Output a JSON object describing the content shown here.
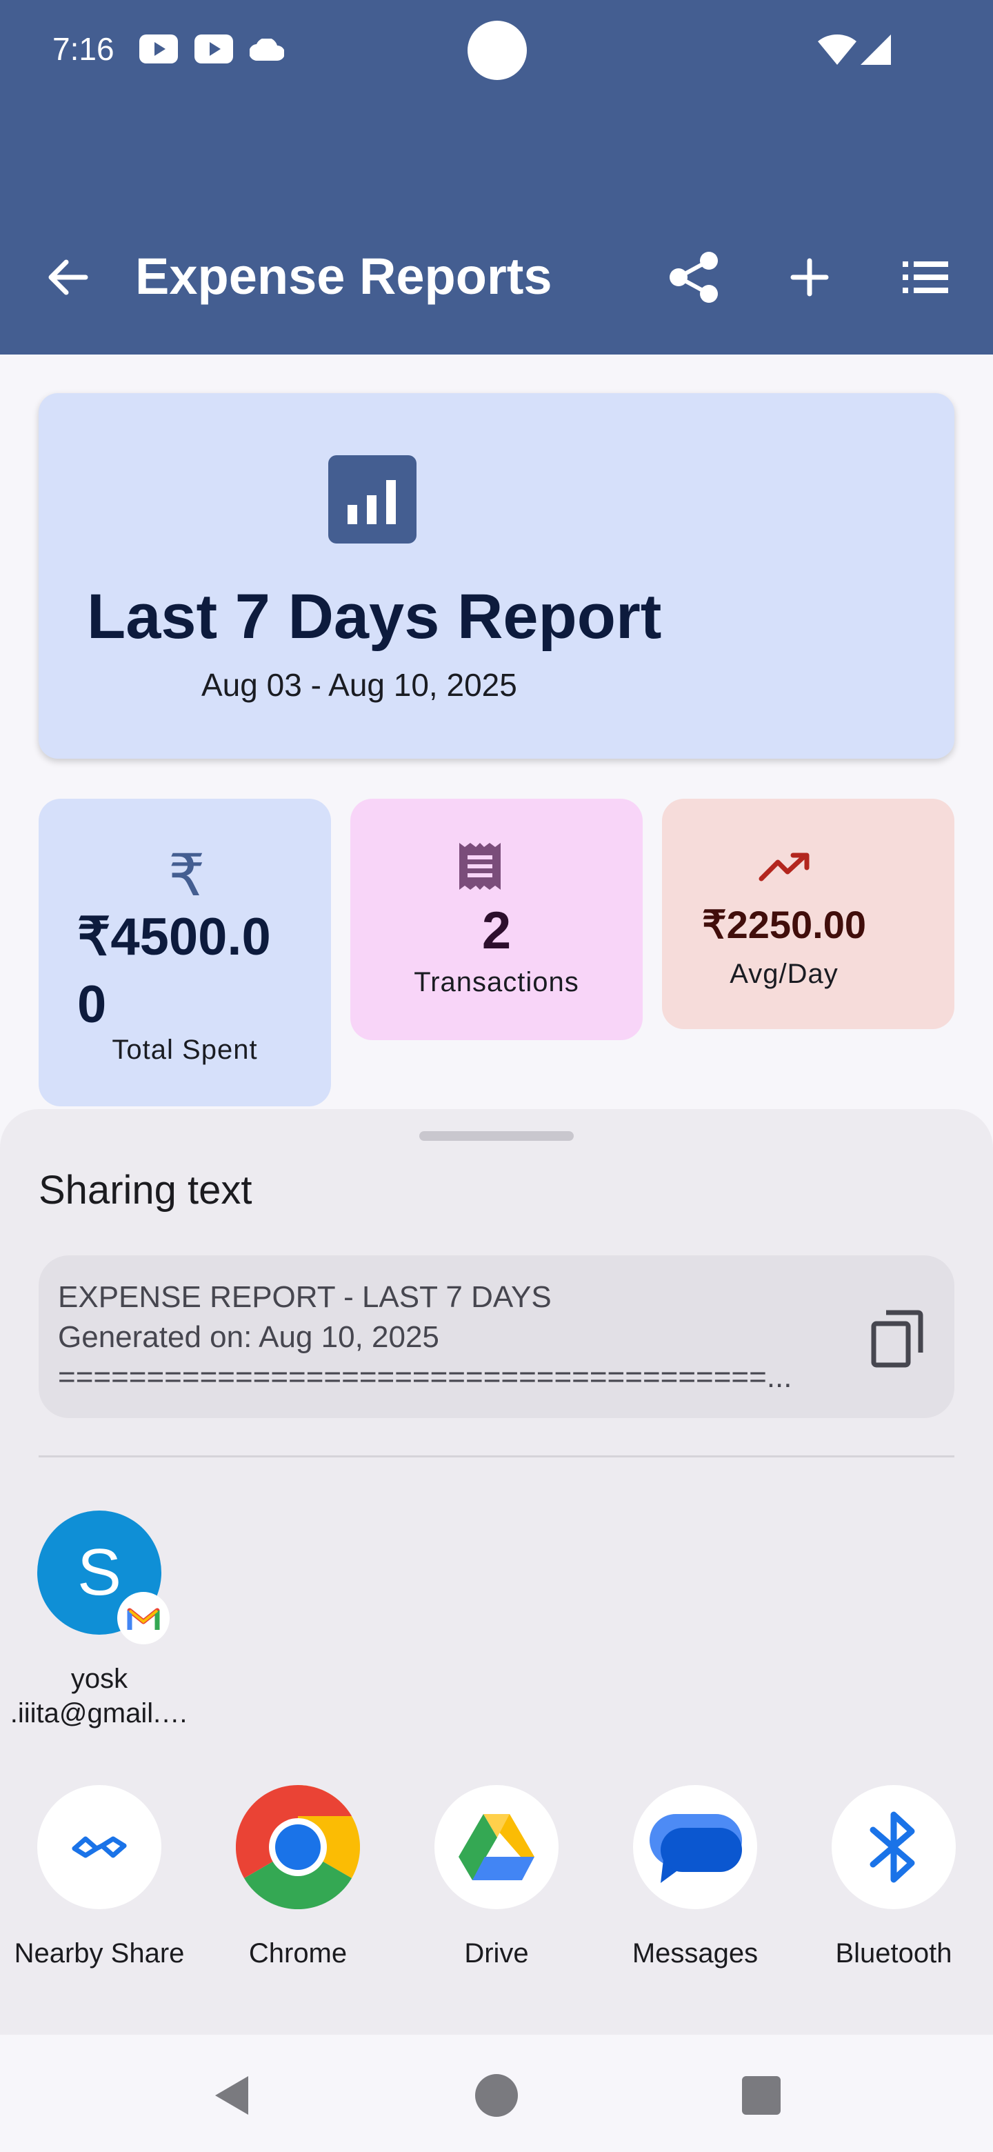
{
  "status_bar": {
    "time": "7:16",
    "icons": [
      "youtube-icon",
      "youtube-icon",
      "cloud-icon",
      "wifi-icon",
      "signal-icon"
    ]
  },
  "toolbar": {
    "title": "Expense Reports",
    "actions": [
      "back-arrow-icon",
      "share-icon",
      "add-icon",
      "list-icon"
    ]
  },
  "report": {
    "icon": "bar-chart-icon",
    "title": "Last 7 Days Report",
    "date_range": "Aug 03 - Aug 10, 2025"
  },
  "stats": [
    {
      "icon": "rupee-icon",
      "value_line1": "₹4500.0",
      "value_line2": "0",
      "label": "Total Spent"
    },
    {
      "icon": "receipt-icon",
      "value": "2",
      "label": "Transactions"
    },
    {
      "icon": "trending-up-icon",
      "value": "₹2250.00",
      "label": "Avg/Day"
    }
  ],
  "share_sheet": {
    "title": "Sharing text",
    "preview_lines": [
      "EXPENSE REPORT - LAST 7 DAYS",
      "Generated on: Aug 10, 2025",
      "========================================..."
    ],
    "contact": {
      "initial": "S",
      "name_line1": "yosk",
      "name_line2": ".iiita@gmail.…"
    },
    "apps": [
      {
        "label": "Nearby Share",
        "icon": "nearby-share-icon"
      },
      {
        "label": "Chrome",
        "icon": "chrome-icon"
      },
      {
        "label": "Drive",
        "icon": "drive-icon"
      },
      {
        "label": "Messages",
        "icon": "messages-icon"
      },
      {
        "label": "Bluetooth",
        "icon": "bluetooth-icon"
      }
    ]
  },
  "colors": {
    "app_bar": "#445e91",
    "hero_card": "#d6e0fa",
    "stat_pink": "#f8d5f8",
    "stat_red": "#f6dcda",
    "sheet": "#edebf0"
  }
}
